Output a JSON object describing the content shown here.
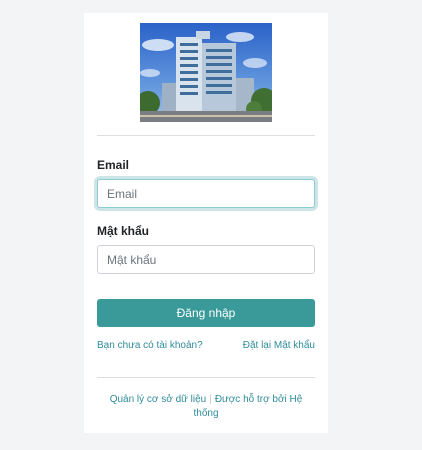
{
  "form": {
    "email_label": "Email",
    "email_placeholder": "Email",
    "password_label": "Mật khẩu",
    "password_placeholder": "Mật khẩu",
    "submit_label": "Đăng nhập"
  },
  "links": {
    "no_account": "Bạn chưa có tài khoản?",
    "reset_password": "Đặt lại Mật khẩu"
  },
  "footer": {
    "database_manager": "Quản lý cơ sở dữ liệu",
    "powered_by": "Được hỗ trợ bởi Hệ thống"
  },
  "colors": {
    "primary": "#3a9a9a",
    "link": "#2f8c9a",
    "focus_border": "#8ccbd2"
  }
}
